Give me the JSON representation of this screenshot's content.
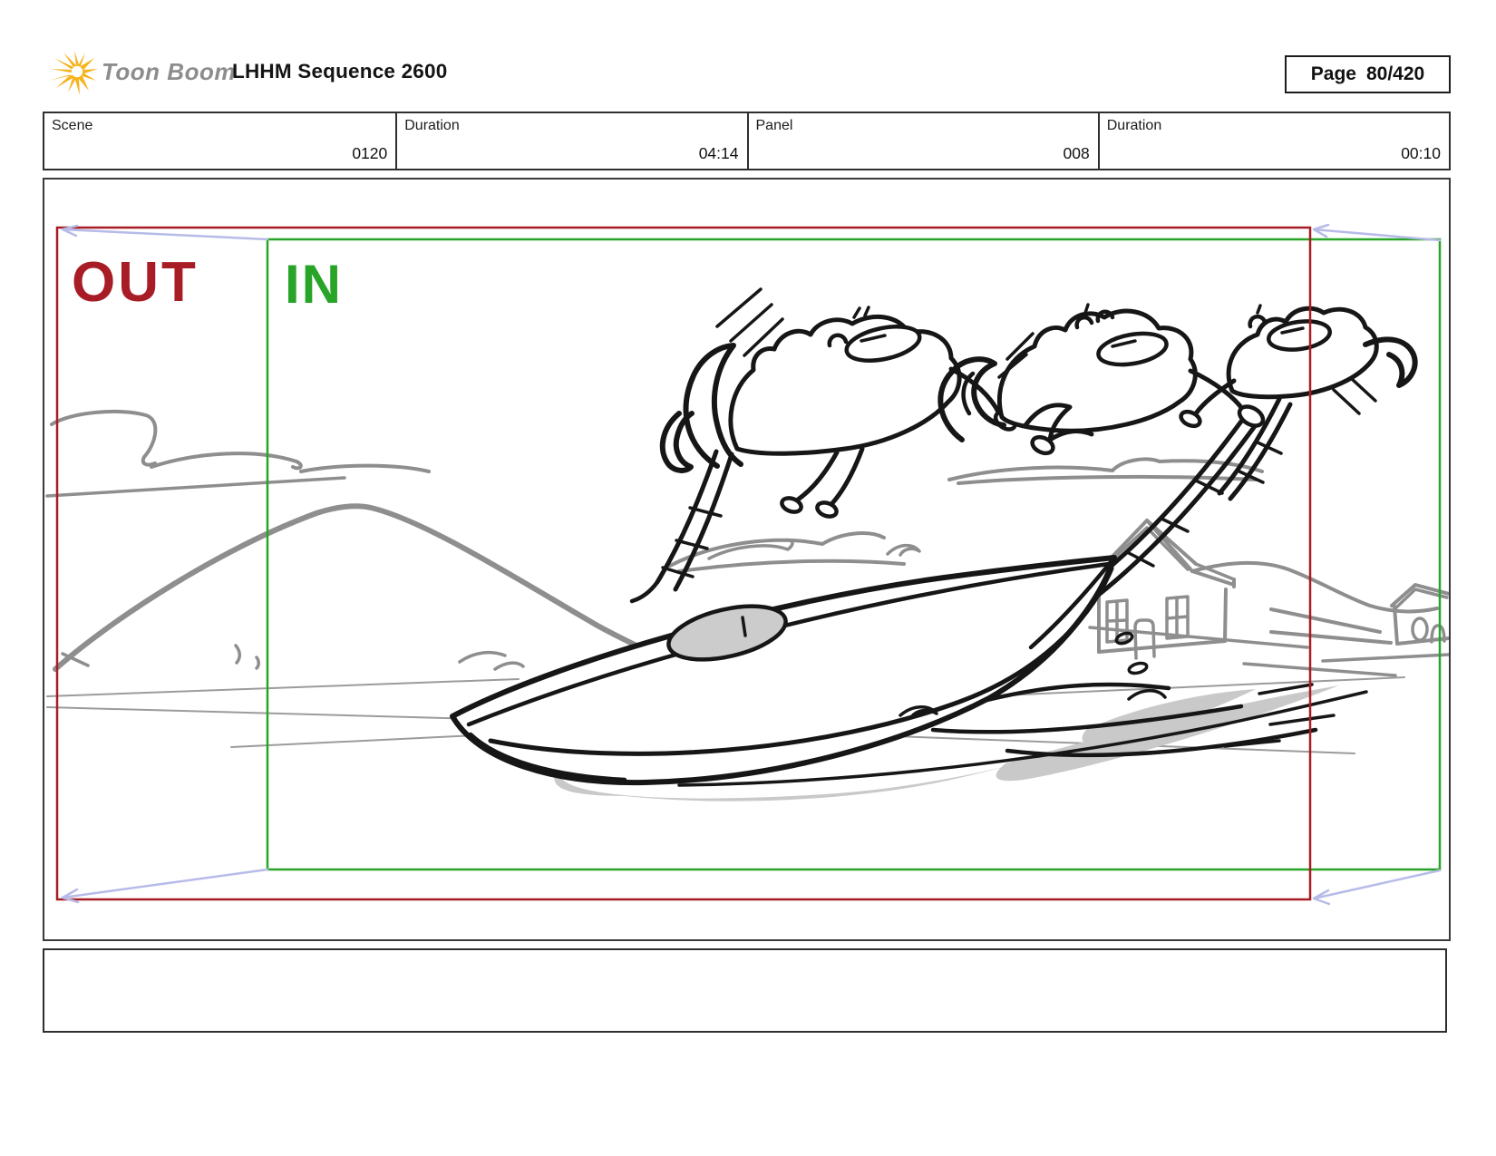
{
  "header": {
    "logo_text": "Toon Boom",
    "title": "LHHM Sequence 2600",
    "page_label": "Page",
    "page_value": "80/420"
  },
  "info_bar": {
    "cells": [
      {
        "label": "Scene",
        "value": "0120"
      },
      {
        "label": "Duration",
        "value": "04:14"
      },
      {
        "label": "Panel",
        "value": "008"
      },
      {
        "label": "Duration",
        "value": "00:10"
      }
    ]
  },
  "panel": {
    "camera": {
      "out_label": "OUT",
      "in_label": "IN",
      "out_color": "#a81c26",
      "in_color": "#28a428",
      "arrow_color": "#b7bbe8"
    }
  },
  "icons": {
    "logo": "toonboom-starburst-icon",
    "logo_color": "#f5b31c"
  },
  "caption": {
    "text": ""
  }
}
